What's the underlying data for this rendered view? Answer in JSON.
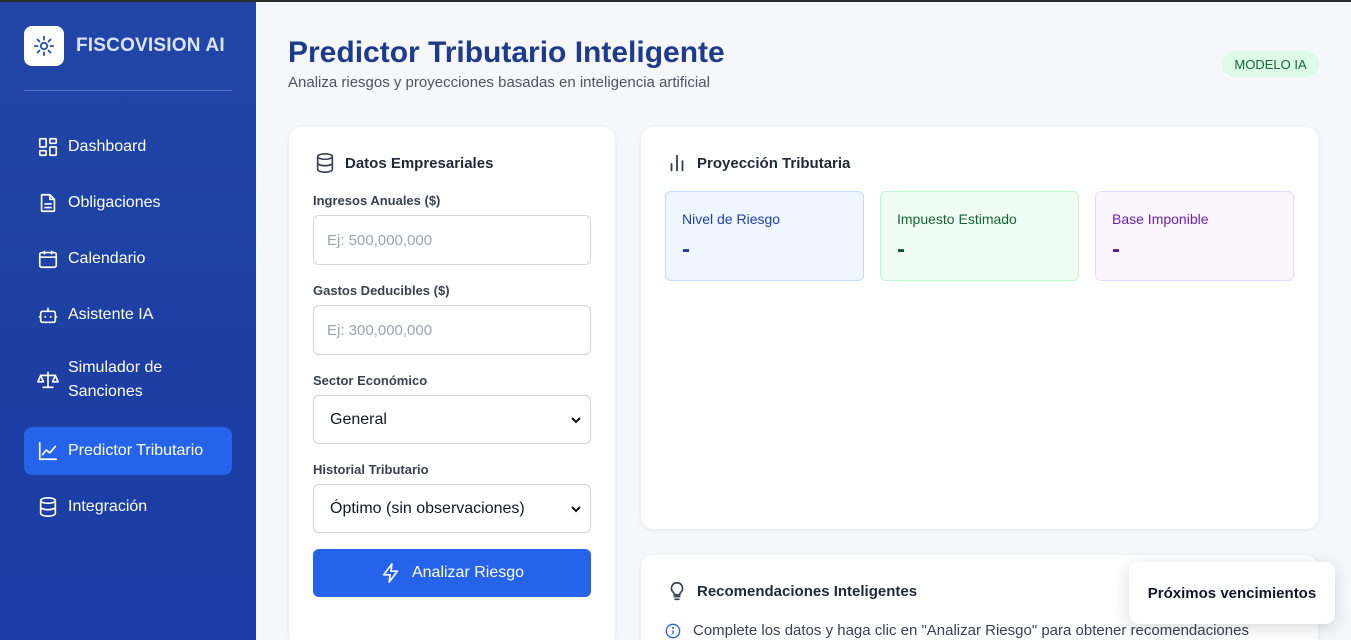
{
  "sidebar": {
    "brand": "FISCOVISION AI",
    "items": [
      {
        "label": "Dashboard",
        "icon": "dashboard-icon"
      },
      {
        "label": "Obligaciones",
        "icon": "document-icon"
      },
      {
        "label": "Calendario",
        "icon": "calendar-icon"
      },
      {
        "label": "Asistente IA",
        "icon": "robot-icon"
      },
      {
        "label_line1": "Simulador de",
        "label_line2": "Sanciones",
        "icon": "scale-icon"
      },
      {
        "label": "Predictor Tributario",
        "icon": "chart-line-icon",
        "active": true
      },
      {
        "label": "Integración",
        "icon": "database-icon"
      }
    ]
  },
  "header": {
    "title": "Predictor Tributario Inteligente",
    "subtitle": "Analiza riesgos y proyecciones basadas en inteligencia artificial",
    "badge": "MODELO IA"
  },
  "form": {
    "title": "Datos Empresariales",
    "ingresos_label": "Ingresos Anuales ($)",
    "ingresos_placeholder": "Ej: 500,000,000",
    "gastos_label": "Gastos Deducibles ($)",
    "gastos_placeholder": "Ej: 300,000,000",
    "sector_label": "Sector Económico",
    "sector_value": "General",
    "historial_label": "Historial Tributario",
    "historial_value": "Óptimo (sin observaciones)",
    "submit_label": "Analizar Riesgo"
  },
  "projection": {
    "title": "Proyección Tributaria",
    "metrics": [
      {
        "label": "Nivel de Riesgo",
        "value": "-"
      },
      {
        "label": "Impuesto Estimado",
        "value": "-"
      },
      {
        "label": "Base Imponible",
        "value": "-"
      }
    ]
  },
  "recommendations": {
    "title": "Recomendaciones Inteligentes",
    "info": "Complete los datos y haga clic en \"Analizar Riesgo\" para obtener recomendaciones"
  },
  "toast": {
    "label": "Próximos vencimientos"
  },
  "colors": {
    "sidebar": "#1f43a6",
    "accent": "#2563eb",
    "title": "#1e3a8a",
    "badge_bg": "#dcfce7"
  }
}
